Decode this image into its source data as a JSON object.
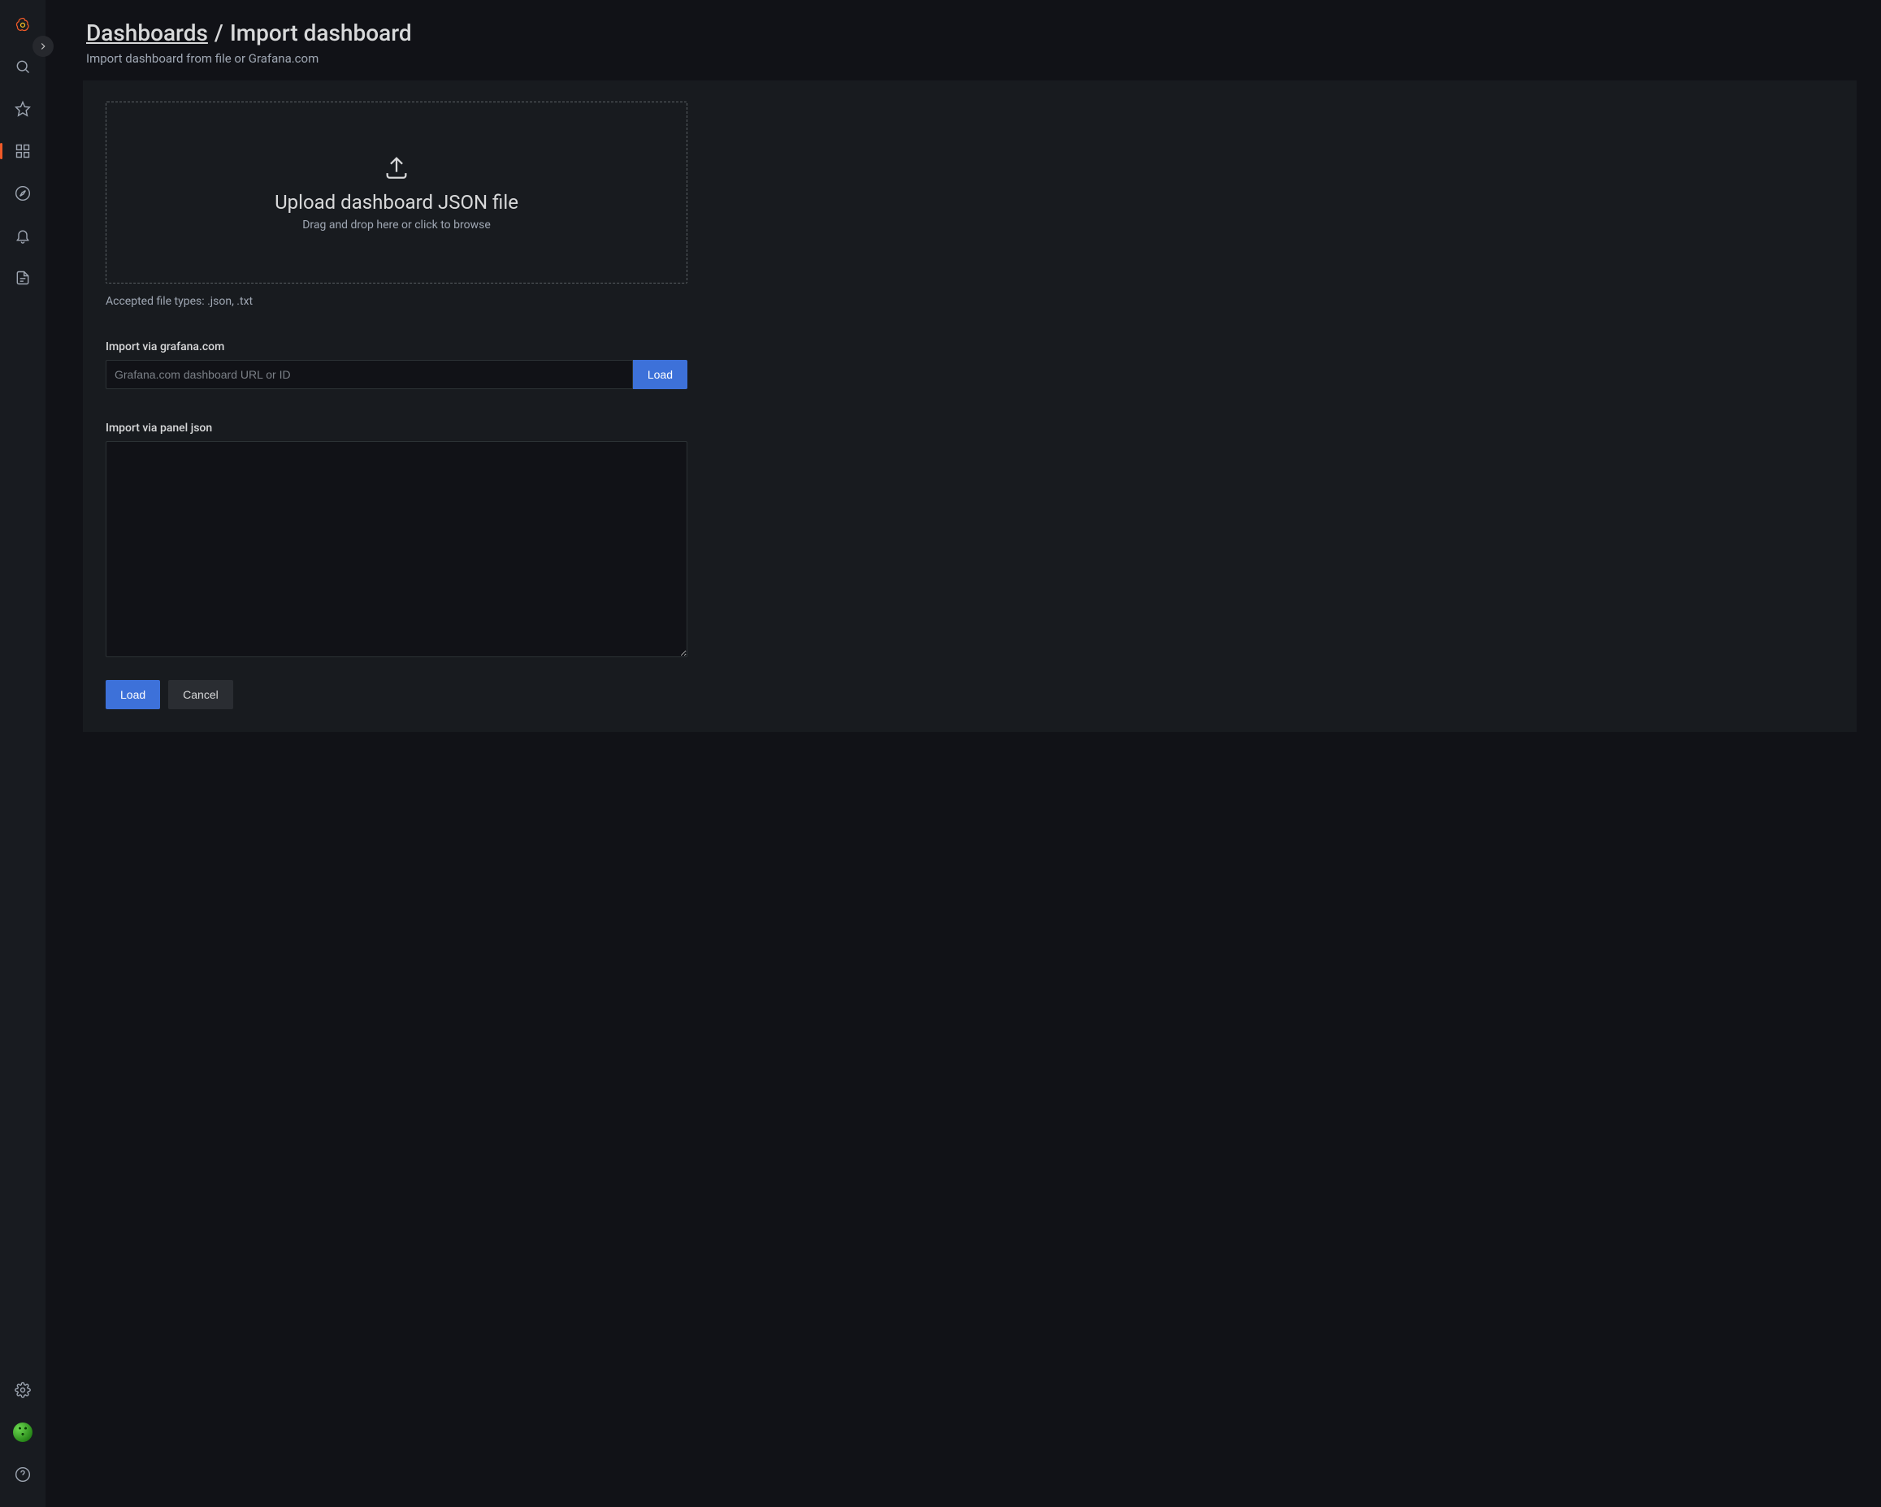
{
  "sidebar": {
    "items": [
      {
        "name": "grafana-logo"
      },
      {
        "name": "search"
      },
      {
        "name": "starred"
      },
      {
        "name": "dashboards",
        "active": true
      },
      {
        "name": "explore"
      },
      {
        "name": "alerting"
      },
      {
        "name": "admin-doc"
      }
    ],
    "bottom": [
      {
        "name": "configuration"
      },
      {
        "name": "avatar"
      },
      {
        "name": "help"
      }
    ]
  },
  "header": {
    "breadcrumb_root": "Dashboards",
    "separator": "/",
    "breadcrumb_current": "Import dashboard",
    "subtitle": "Import dashboard from file or Grafana.com"
  },
  "upload": {
    "title": "Upload dashboard JSON file",
    "hint": "Drag and drop here or click to browse",
    "accepted": "Accepted file types: .json, .txt"
  },
  "import_url": {
    "label": "Import via grafana.com",
    "placeholder": "Grafana.com dashboard URL or ID",
    "button": "Load"
  },
  "import_json": {
    "label": "Import via panel json",
    "value": ""
  },
  "actions": {
    "load": "Load",
    "cancel": "Cancel"
  }
}
